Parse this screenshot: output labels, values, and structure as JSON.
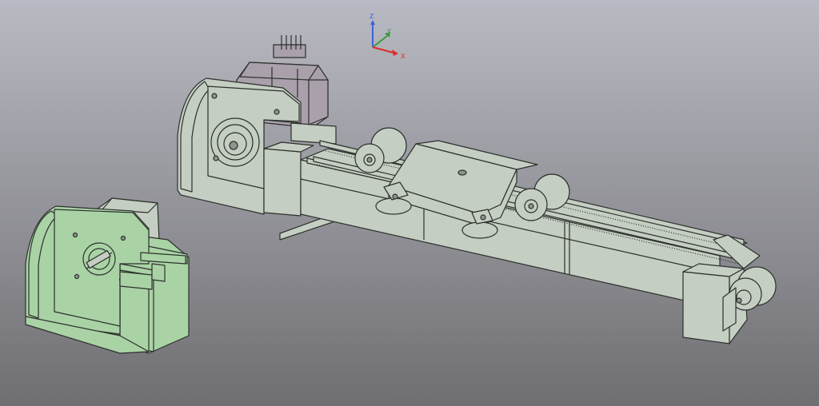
{
  "viewport": {
    "background_top": "#b9bac3",
    "background_bottom": "#6f6f72"
  },
  "axis_gizmo": {
    "x_label": "X",
    "y_label": "Y",
    "z_label": "Z",
    "x_color": "#e02b2b",
    "y_color": "#3a9a3a",
    "z_color": "#3b63d8"
  },
  "model": {
    "part_color": "#c5cec2",
    "selected_part_color": "#a9d3a5",
    "motor_color": "#a9a0ab",
    "edge_color": "#2d302d"
  }
}
